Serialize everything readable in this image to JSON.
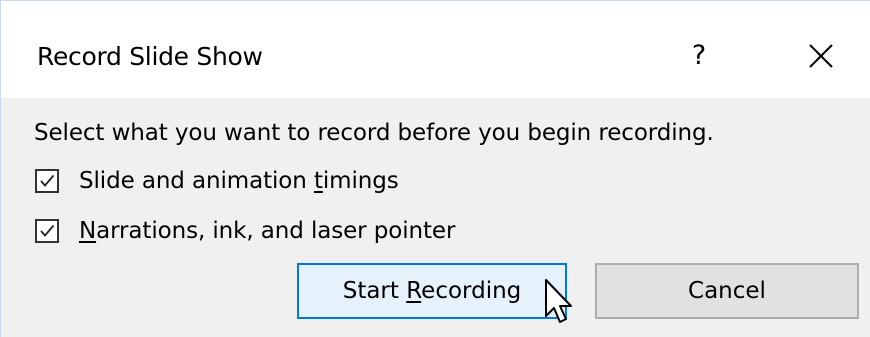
{
  "dialog": {
    "title": "Record Slide Show",
    "help_label": "?",
    "close_icon": "close-icon"
  },
  "instructions": "Select what you want to record before you begin recording.",
  "options": [
    {
      "label_before": "Slide and animation ",
      "label_accel": "t",
      "label_after": "imings",
      "checked": true
    },
    {
      "label_before": "",
      "label_accel": "N",
      "label_after": "arrations, ink, and laser pointer",
      "checked": true
    }
  ],
  "buttons": {
    "start_before": "Start ",
    "start_accel": "R",
    "start_after": "ecording",
    "cancel": "Cancel"
  },
  "colors": {
    "accent": "#0078d7",
    "primary_button_bg": "#e5f1fb",
    "dialog_bg": "#f0f0f0"
  }
}
